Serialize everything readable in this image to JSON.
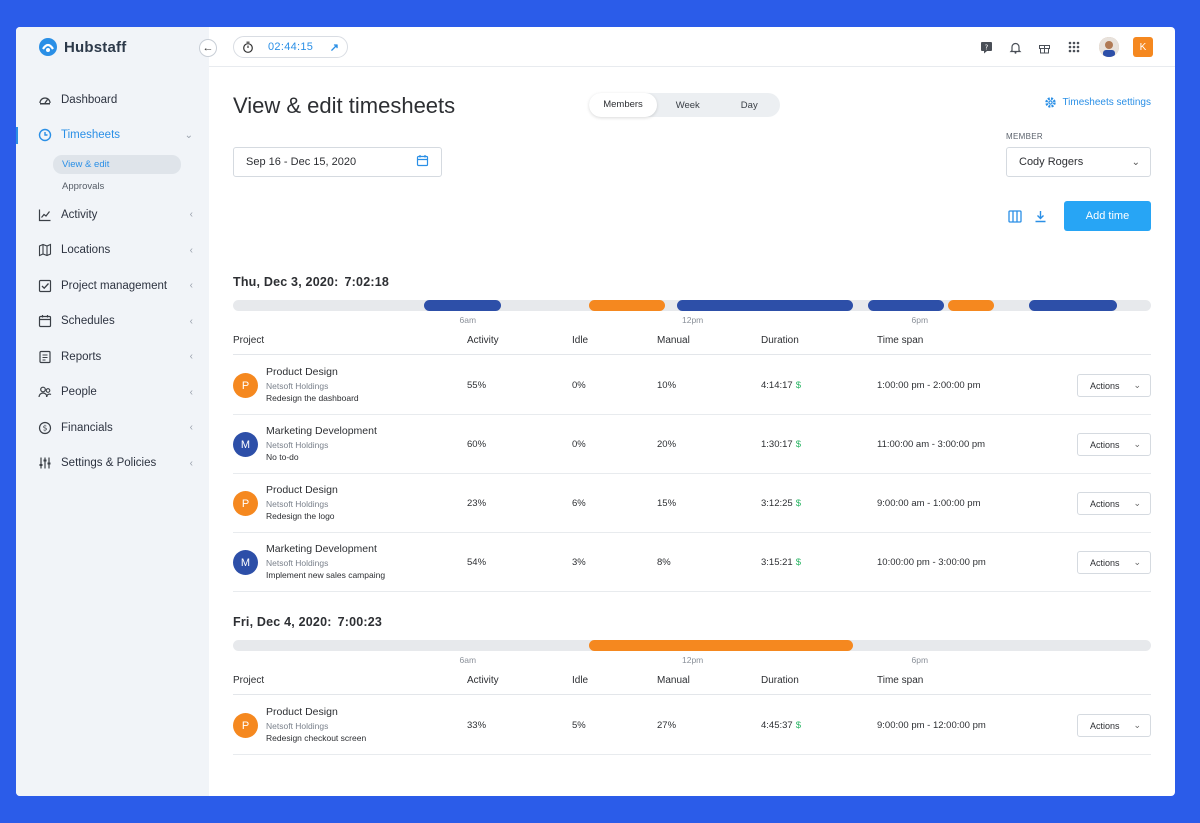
{
  "brand": {
    "name": "Hubstaff"
  },
  "timer": {
    "value": "02:44:15"
  },
  "nav": {
    "items": [
      {
        "label": "Dashboard",
        "icon": "dashboard-icon"
      },
      {
        "label": "Timesheets",
        "icon": "clock-icon",
        "active": true
      },
      {
        "label": "Activity",
        "icon": "activity-icon"
      },
      {
        "label": "Locations",
        "icon": "map-icon"
      },
      {
        "label": "Project management",
        "icon": "checkbox-icon"
      },
      {
        "label": "Schedules",
        "icon": "calendar-icon"
      },
      {
        "label": "Reports",
        "icon": "report-icon"
      },
      {
        "label": "People",
        "icon": "people-icon"
      },
      {
        "label": "Financials",
        "icon": "dollar-icon"
      },
      {
        "label": "Settings & Policies",
        "icon": "sliders-icon"
      }
    ],
    "sub": [
      "View & edit",
      "Approvals"
    ]
  },
  "header": {
    "avatar_initial": "K"
  },
  "page": {
    "title": "View & edit timesheets",
    "tabs": [
      "Members",
      "Week",
      "Day"
    ],
    "settings_link": "Timesheets settings",
    "date_range": "Sep 16 - Dec 15, 2020",
    "member_label": "MEMBER",
    "member_value": "Cody Rogers",
    "add_time": "Add time"
  },
  "columns": [
    "Project",
    "Activity",
    "Idle",
    "Manual",
    "Duration",
    "Time span"
  ],
  "ticks": [
    "6am",
    "12pm",
    "6pm"
  ],
  "actions_label": "Actions",
  "colors": {
    "orange": "#f5881f",
    "navy": "#2d4fa8",
    "accent": "#27a5f5"
  },
  "days": [
    {
      "date": "Thu, Dec 3, 2020:",
      "total": "7:02:18",
      "bars": [
        {
          "color": "navy",
          "start": 5.0,
          "end": 7.0
        },
        {
          "color": "orange",
          "start": 9.3,
          "end": 11.3
        },
        {
          "color": "navy",
          "start": 11.6,
          "end": 16.2
        },
        {
          "color": "navy",
          "start": 16.6,
          "end": 18.6
        },
        {
          "color": "orange",
          "start": 18.7,
          "end": 19.9
        },
        {
          "color": "navy",
          "start": 20.8,
          "end": 23.1
        }
      ],
      "rows": [
        {
          "initial": "P",
          "color": "orange",
          "project": "Product Design",
          "client": "Netsoft Holdings",
          "todo": "Redesign the dashboard",
          "activity": "55%",
          "idle": "0%",
          "manual": "10%",
          "duration": "4:14:17",
          "span": "1:00:00 pm - 2:00:00 pm"
        },
        {
          "initial": "M",
          "color": "navy",
          "project": "Marketing Development",
          "client": "Netsoft Holdings",
          "todo": "No to-do",
          "activity": "60%",
          "idle": "0%",
          "manual": "20%",
          "duration": "1:30:17",
          "span": "11:00:00 am - 3:00:00 pm"
        },
        {
          "initial": "P",
          "color": "orange",
          "project": "Product Design",
          "client": "Netsoft Holdings",
          "todo": "Redesign the logo",
          "activity": "23%",
          "idle": "6%",
          "manual": "15%",
          "duration": "3:12:25",
          "span": "9:00:00 am - 1:00:00 pm"
        },
        {
          "initial": "M",
          "color": "navy",
          "project": "Marketing Development",
          "client": "Netsoft Holdings",
          "todo": "Implement new sales campaing",
          "activity": "54%",
          "idle": "3%",
          "manual": "8%",
          "duration": "3:15:21",
          "span": "10:00:00 pm - 3:00:00 pm"
        }
      ]
    },
    {
      "date": "Fri, Dec 4, 2020:",
      "total": "7:00:23",
      "bars": [
        {
          "color": "orange",
          "start": 9.3,
          "end": 16.2
        }
      ],
      "rows": [
        {
          "initial": "P",
          "color": "orange",
          "project": "Product Design",
          "client": "Netsoft Holdings",
          "todo": "Redesign checkout screen",
          "activity": "33%",
          "idle": "5%",
          "manual": "27%",
          "duration": "4:45:37",
          "span": "9:00:00 pm - 12:00:00 pm"
        }
      ]
    }
  ]
}
